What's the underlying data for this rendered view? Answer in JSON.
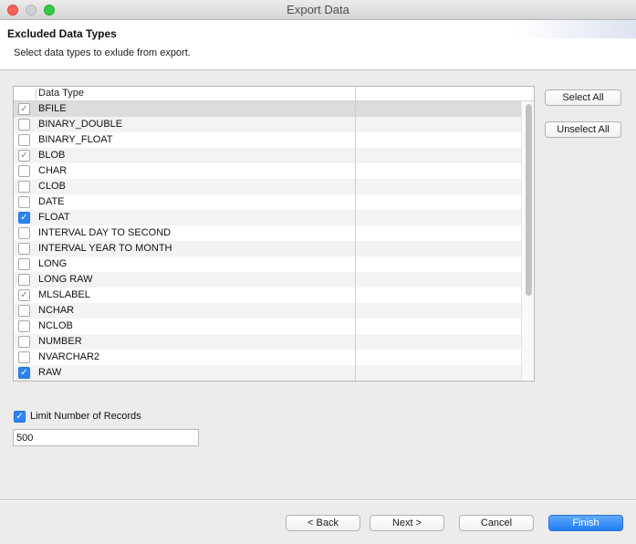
{
  "window": {
    "title": "Export Data"
  },
  "header": {
    "title": "Excluded Data Types",
    "description": "Select data types to exlude from export."
  },
  "table": {
    "column_header": "Data Type",
    "rows": [
      {
        "label": "BFILE",
        "checked": true,
        "style": "gray",
        "selected": true
      },
      {
        "label": "BINARY_DOUBLE",
        "checked": false,
        "style": "none"
      },
      {
        "label": "BINARY_FLOAT",
        "checked": false,
        "style": "none"
      },
      {
        "label": "BLOB",
        "checked": true,
        "style": "gray"
      },
      {
        "label": "CHAR",
        "checked": false,
        "style": "none"
      },
      {
        "label": "CLOB",
        "checked": false,
        "style": "none"
      },
      {
        "label": "DATE",
        "checked": false,
        "style": "none"
      },
      {
        "label": "FLOAT",
        "checked": true,
        "style": "blue"
      },
      {
        "label": "INTERVAL DAY TO SECOND",
        "checked": false,
        "style": "none"
      },
      {
        "label": "INTERVAL YEAR TO MONTH",
        "checked": false,
        "style": "none"
      },
      {
        "label": "LONG",
        "checked": false,
        "style": "none"
      },
      {
        "label": "LONG RAW",
        "checked": false,
        "style": "none"
      },
      {
        "label": "MLSLABEL",
        "checked": true,
        "style": "gray"
      },
      {
        "label": "NCHAR",
        "checked": false,
        "style": "none"
      },
      {
        "label": "NCLOB",
        "checked": false,
        "style": "none"
      },
      {
        "label": "NUMBER",
        "checked": false,
        "style": "none"
      },
      {
        "label": "NVARCHAR2",
        "checked": false,
        "style": "none"
      },
      {
        "label": "RAW",
        "checked": true,
        "style": "blue"
      }
    ]
  },
  "side_buttons": {
    "select_all": "Select All",
    "unselect_all": "Unselect All"
  },
  "limit": {
    "label": "Limit Number of Records",
    "checked": true,
    "value": "500"
  },
  "footer": {
    "back": "< Back",
    "next": "Next >",
    "cancel": "Cancel",
    "finish": "Finish"
  },
  "colors": {
    "accent": "#2d83f6",
    "selected_row": "#dcdcdc",
    "alt_row": "#f3f3f3"
  },
  "icons": {
    "check": "checkmark-icon"
  }
}
